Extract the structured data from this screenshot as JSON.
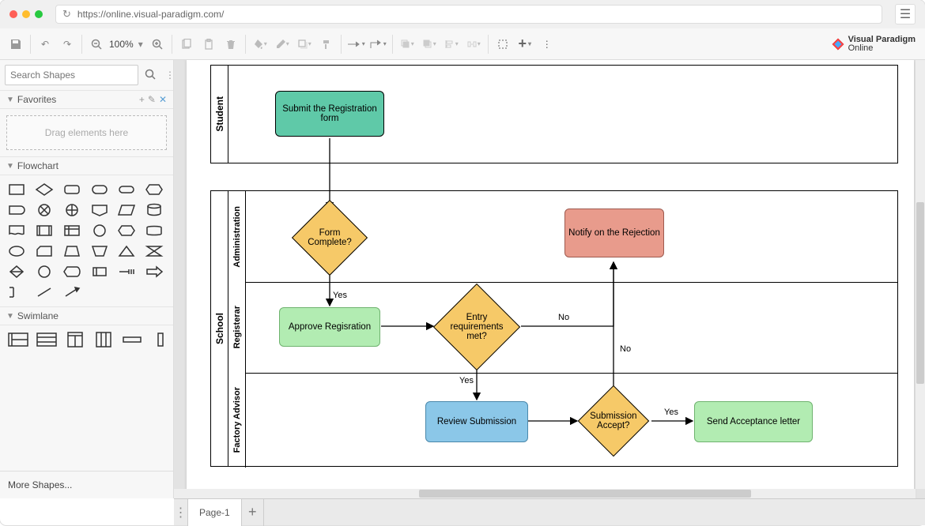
{
  "browser": {
    "url": "https://online.visual-paradigm.com/"
  },
  "toolbar": {
    "zoom": "100%"
  },
  "sidebar": {
    "search_placeholder": "Search Shapes",
    "favorites": {
      "title": "Favorites",
      "drop_hint": "Drag elements here"
    },
    "flowchart": {
      "title": "Flowchart"
    },
    "swimlane": {
      "title": "Swimlane"
    },
    "more": "More Shapes..."
  },
  "tabs": {
    "page1": "Page-1"
  },
  "logo": {
    "line1": "Visual Paradigm",
    "line2": "Online"
  },
  "diagram": {
    "pool1": {
      "name": "Student"
    },
    "pool2": {
      "name": "School",
      "lanes": {
        "admin": "Administration",
        "registrar": "Registerar",
        "advisor": "Factory Advisor"
      }
    },
    "nodes": {
      "submit": "Submit the Registration form",
      "formComplete": "Form Complete?",
      "notify": "Notify on the Rejection",
      "approve": "Approve Regisration",
      "entryReq": "Entry requirements met?",
      "review": "Review Submission",
      "subAccept": "Submission Accept?",
      "sendAccept": "Send Acceptance letter"
    },
    "labels": {
      "yes1": "Yes",
      "no1": "No",
      "yes2": "Yes",
      "no2": "No",
      "yes3": "Yes"
    }
  }
}
